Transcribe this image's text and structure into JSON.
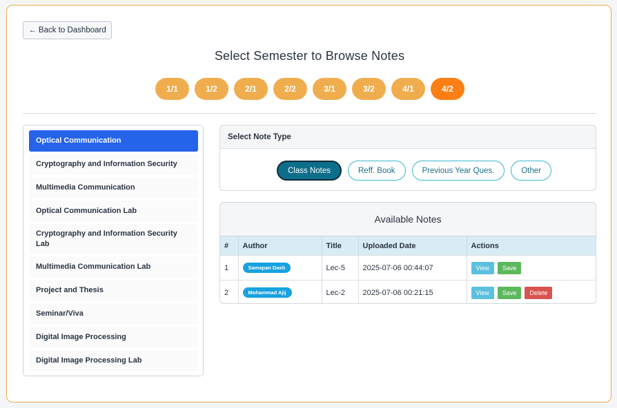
{
  "back_button": {
    "label": "← Back to Dashboard"
  },
  "page_title": "Select Semester to Browse Notes",
  "semesters": [
    {
      "label": "1/1",
      "active": false
    },
    {
      "label": "1/2",
      "active": false
    },
    {
      "label": "2/1",
      "active": false
    },
    {
      "label": "2/2",
      "active": false
    },
    {
      "label": "3/1",
      "active": false
    },
    {
      "label": "3/2",
      "active": false
    },
    {
      "label": "4/1",
      "active": false
    },
    {
      "label": "4/2",
      "active": true
    }
  ],
  "courses": [
    {
      "label": "Optical Communication",
      "active": true
    },
    {
      "label": "Cryptography and Information Security",
      "active": false
    },
    {
      "label": "Multimedia Communication",
      "active": false
    },
    {
      "label": "Optical Communication Lab",
      "active": false
    },
    {
      "label": "Cryptography and Information Security Lab",
      "active": false
    },
    {
      "label": "Multimedia Communication Lab",
      "active": false
    },
    {
      "label": "Project and Thesis",
      "active": false
    },
    {
      "label": "Seminar/Viva",
      "active": false
    },
    {
      "label": "Digital Image Processing",
      "active": false
    },
    {
      "label": "Digital Image Processing Lab",
      "active": false
    }
  ],
  "note_type": {
    "heading": "Select Note Type",
    "options": [
      {
        "label": "Class Notes",
        "active": true
      },
      {
        "label": "Reff. Book",
        "active": false
      },
      {
        "label": "Previous Year Ques.",
        "active": false
      },
      {
        "label": "Other",
        "active": false
      }
    ]
  },
  "notes": {
    "title": "Available Notes",
    "columns": [
      "#",
      "Author",
      "Title",
      "Uploaded Date",
      "Actions"
    ],
    "rows": [
      {
        "num": "1",
        "author": "Samapan Dash",
        "title": "Lec-5",
        "date": "2025-07-06 00:44:07",
        "actions": [
          "View",
          "Save"
        ]
      },
      {
        "num": "2",
        "author": "Mohammad Ajij",
        "title": "Lec-2",
        "date": "2025-07-06 00:21:15",
        "actions": [
          "View",
          "Save",
          "Delete"
        ]
      }
    ]
  },
  "colors": {
    "accent": "#f0ad4e",
    "accent_active": "#fd7e14",
    "sidebar_active": "#2563eb",
    "frame_border": "#f0a94a"
  }
}
